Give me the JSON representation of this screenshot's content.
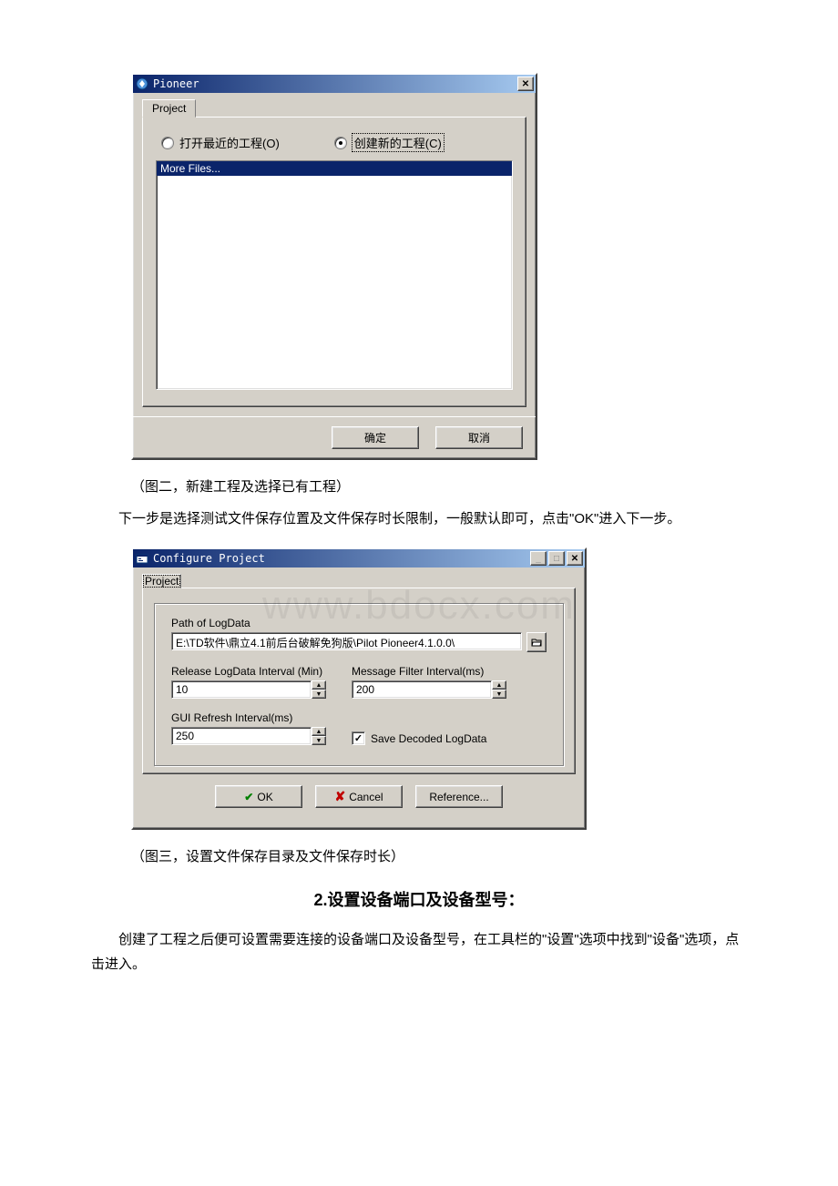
{
  "dialog1": {
    "title": "Pioneer",
    "tab": "Project",
    "radio_open": "打开最近的工程(O)",
    "radio_create": "创建新的工程(C)",
    "list_item": "More Files...",
    "ok": "确定",
    "cancel": "取消"
  },
  "caption1": "（图二，新建工程及选择已有工程）",
  "para1": "下一步是选择测试文件保存位置及文件保存时长限制，一般默认即可，点击\"OK\"进入下一步。",
  "dialog2": {
    "title": "Configure Project",
    "tab": "Project",
    "path_label": "Path of LogData",
    "path_value": "E:\\TD软件\\鼎立4.1前后台破解免狗版\\Pilot Pioneer4.1.0.0\\",
    "release_label": "Release LogData Interval (Min)",
    "release_value": "10",
    "filter_label": "Message Filter Interval(ms)",
    "filter_value": "200",
    "gui_label": "GUI Refresh Interval(ms)",
    "gui_value": "250",
    "save_decoded": "Save Decoded LogData",
    "ok": "OK",
    "cancel": "Cancel",
    "reference": "Reference..."
  },
  "caption2": "（图三，设置文件保存目录及文件保存时长）",
  "heading": "2.设置设备端口及设备型号：",
  "para2": "创建了工程之后便可设置需要连接的设备端口及设备型号，在工具栏的\"设置\"选项中找到\"设备\"选项，点击进入。",
  "watermark": "www.bdocx.com"
}
